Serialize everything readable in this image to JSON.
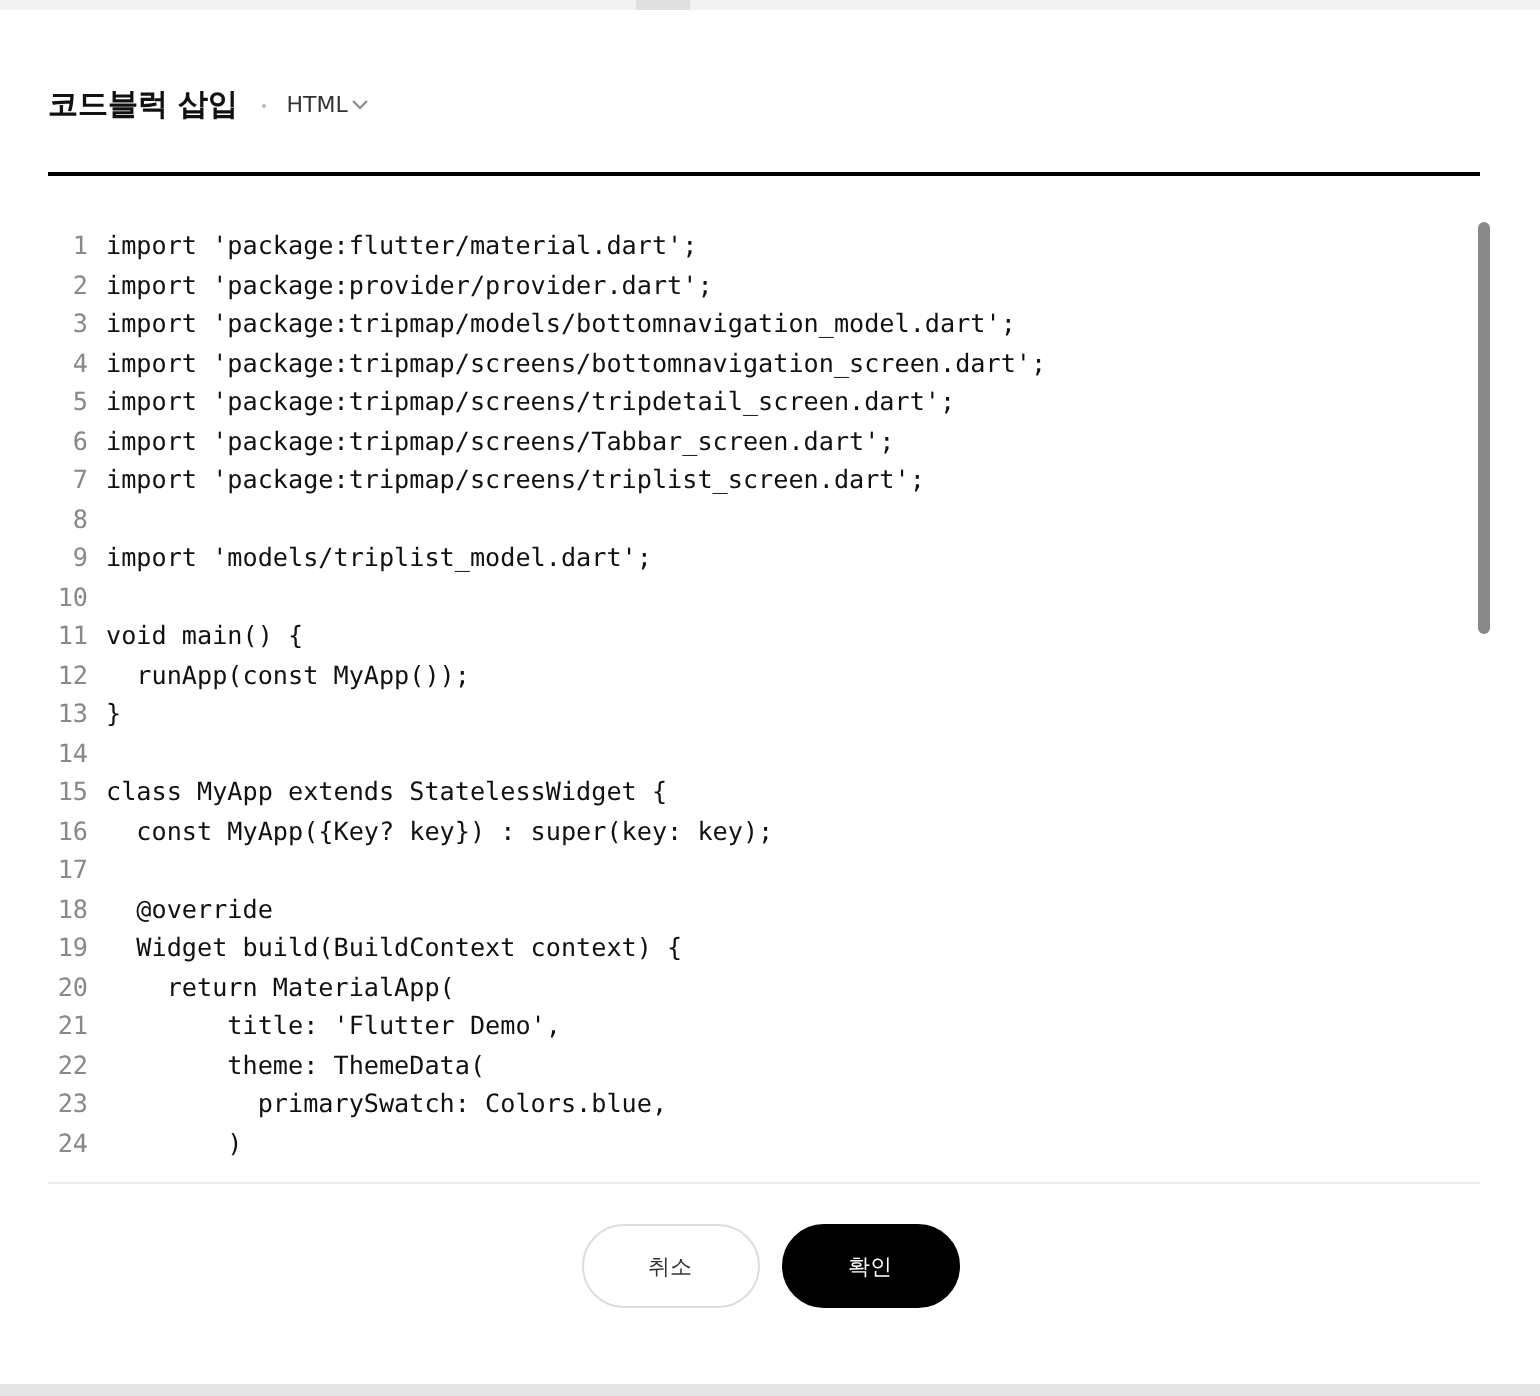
{
  "dialog": {
    "title": "코드블럭 삽입",
    "language": "HTML"
  },
  "code_lines": [
    {
      "number": "1",
      "text": "import 'package:flutter/material.dart';"
    },
    {
      "number": "2",
      "text": "import 'package:provider/provider.dart';"
    },
    {
      "number": "3",
      "text": "import 'package:tripmap/models/bottomnavigation_model.dart';"
    },
    {
      "number": "4",
      "text": "import 'package:tripmap/screens/bottomnavigation_screen.dart';"
    },
    {
      "number": "5",
      "text": "import 'package:tripmap/screens/tripdetail_screen.dart';"
    },
    {
      "number": "6",
      "text": "import 'package:tripmap/screens/Tabbar_screen.dart';"
    },
    {
      "number": "7",
      "text": "import 'package:tripmap/screens/triplist_screen.dart';"
    },
    {
      "number": "8"
    },
    {
      "number": "9",
      "text": "import 'models/triplist_model.dart';"
    },
    {
      "number": "10"
    },
    {
      "number": "11",
      "text": "void main() {"
    },
    {
      "number": "12",
      "text": "  runApp(const MyApp());"
    },
    {
      "number": "13",
      "text": "}"
    },
    {
      "number": "14"
    },
    {
      "number": "15",
      "text": "class MyApp extends StatelessWidget {"
    },
    {
      "number": "16",
      "text": "  const MyApp({Key? key}) : super(key: key);"
    },
    {
      "number": "17"
    },
    {
      "number": "18",
      "text": "  @override"
    },
    {
      "number": "19",
      "text": "  Widget build(BuildContext context) {"
    },
    {
      "number": "20",
      "text": "    return MaterialApp("
    },
    {
      "number": "21",
      "text": "        title: 'Flutter Demo',"
    },
    {
      "number": "22",
      "text": "        theme: ThemeData("
    },
    {
      "number": "23",
      "text": "          primarySwatch: Colors.blue,"
    },
    {
      "number": "24",
      "text": "        )"
    }
  ],
  "buttons": [
    {
      "label": "취소",
      "kind": "secondary"
    },
    {
      "label": "확인",
      "kind": "primary"
    }
  ]
}
